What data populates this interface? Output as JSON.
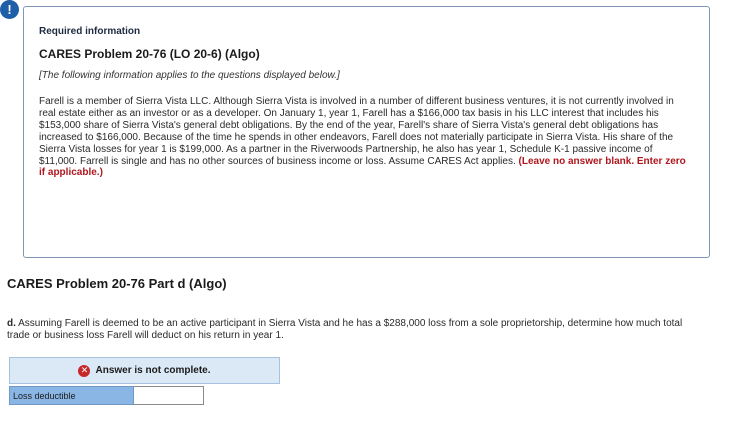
{
  "alert_icon_glyph": "!",
  "info": {
    "eyebrow": "Required information",
    "title": "CARES Problem 20-76 (LO 20-6) (Algo)",
    "note": "[The following information applies to the questions displayed below.]",
    "body": "Farell is a member of Sierra Vista LLC. Although Sierra Vista is involved in a number of different business ventures, it is not currently involved in real estate either as an investor or as a developer. On January 1, year 1, Farell has a $166,000 tax basis in his LLC interest that includes his $153,000 share of Sierra Vista's general debt obligations. By the end of the year, Farell's share of Sierra Vista's general debt obligations has increased to $166,000. Because of the time he spends in other endeavors, Farell does not materially participate in Sierra Vista. His share of the Sierra Vista losses for year 1 is $199,000. As a partner in the Riverwoods Partnership, he also has year 1, Schedule K-1 passive income of $11,000. Farrell is single and has no other sources of business income or loss. Assume CARES Act applies.",
    "instruction": "(Leave no answer blank. Enter zero if applicable.)"
  },
  "part": {
    "title": "CARES Problem 20-76 Part d (Algo)",
    "question_label": "d.",
    "question_text": "Assuming Farell is deemed to be an active participant in Sierra Vista and he has a $288,000 loss from a sole proprietorship, determine how much total trade or business loss Farell will deduct on his return in year 1."
  },
  "answer": {
    "status_glyph": "✕",
    "status_text": "Answer is not complete.",
    "row_label": "Loss deductible",
    "row_value": ""
  }
}
